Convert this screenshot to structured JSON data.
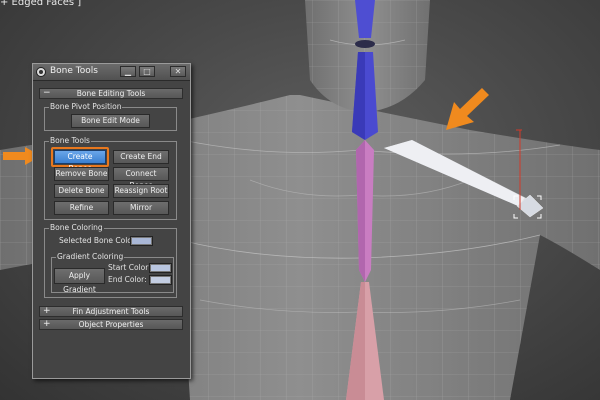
{
  "viewport": {
    "label": "+ Edged Faces ]"
  },
  "window": {
    "title": "Bone Tools",
    "controls": {
      "minimize": "▁",
      "restore": "□",
      "close": "✕"
    }
  },
  "rollouts": {
    "bone_editing": {
      "sign": "−",
      "label": "Bone Editing Tools"
    },
    "fin_adjustment": {
      "sign": "+",
      "label": "Fin Adjustment Tools"
    },
    "object_properties": {
      "sign": "+",
      "label": "Object Properties"
    }
  },
  "bone_pivot": {
    "title": "Bone Pivot Position",
    "edit_mode": "Bone Edit Mode"
  },
  "bone_tools": {
    "title": "Bone Tools",
    "buttons": {
      "create_bones": "Create Bones",
      "create_end": "Create End",
      "remove_bone": "Remove Bone",
      "connect_bones": "Connect Bones",
      "delete_bone": "Delete Bone",
      "reassign_root": "Reassign Root",
      "refine": "Refine",
      "mirror": "Mirror"
    }
  },
  "bone_coloring": {
    "title": "Bone Coloring",
    "selected_color_label": "Selected Bone Color:",
    "selected_color": "#a9b7d6",
    "gradient": {
      "title": "Gradient Coloring",
      "apply": "Apply Gradient",
      "start_label": "Start Color:",
      "start_color": "#b9c6e0",
      "end_label": "End Color:",
      "end_color": "#c3cde2"
    }
  },
  "colors": {
    "highlight": "#e8781e",
    "active_button": "#4a8fdc"
  }
}
